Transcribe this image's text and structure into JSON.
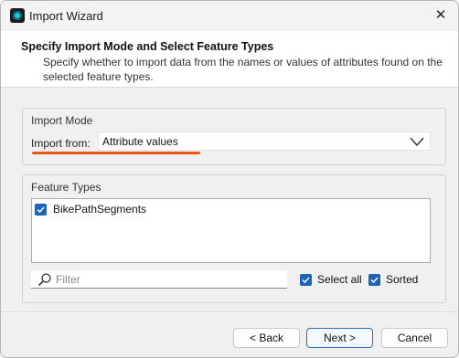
{
  "window": {
    "title": "Import Wizard",
    "close_glyph": "✕"
  },
  "header": {
    "title": "Specify Import Mode and Select Feature Types",
    "description": "Specify whether to import data from the names or values of attributes found on the selected feature types."
  },
  "import_mode": {
    "group_label": "Import Mode",
    "import_from_label": "Import from:",
    "selected_value": "Attribute values",
    "highlight_color": "#e8561a"
  },
  "feature_types": {
    "group_label": "Feature Types",
    "items": [
      {
        "label": "BikePathSegments",
        "checked": true
      }
    ],
    "filter_placeholder": "Filter",
    "select_all_label": "Select all",
    "select_all_checked": true,
    "sorted_label": "Sorted",
    "sorted_checked": true
  },
  "footer": {
    "back_label": "< Back",
    "next_label": "Next >",
    "cancel_label": "Cancel"
  },
  "colors": {
    "accent": "#1e63b5",
    "primary_border": "#2b6bc4"
  },
  "icons": {
    "app": "import-wizard-app-icon",
    "close": "close-icon",
    "chevron": "chevron-down-icon",
    "search": "search-icon",
    "check": "check-icon"
  }
}
